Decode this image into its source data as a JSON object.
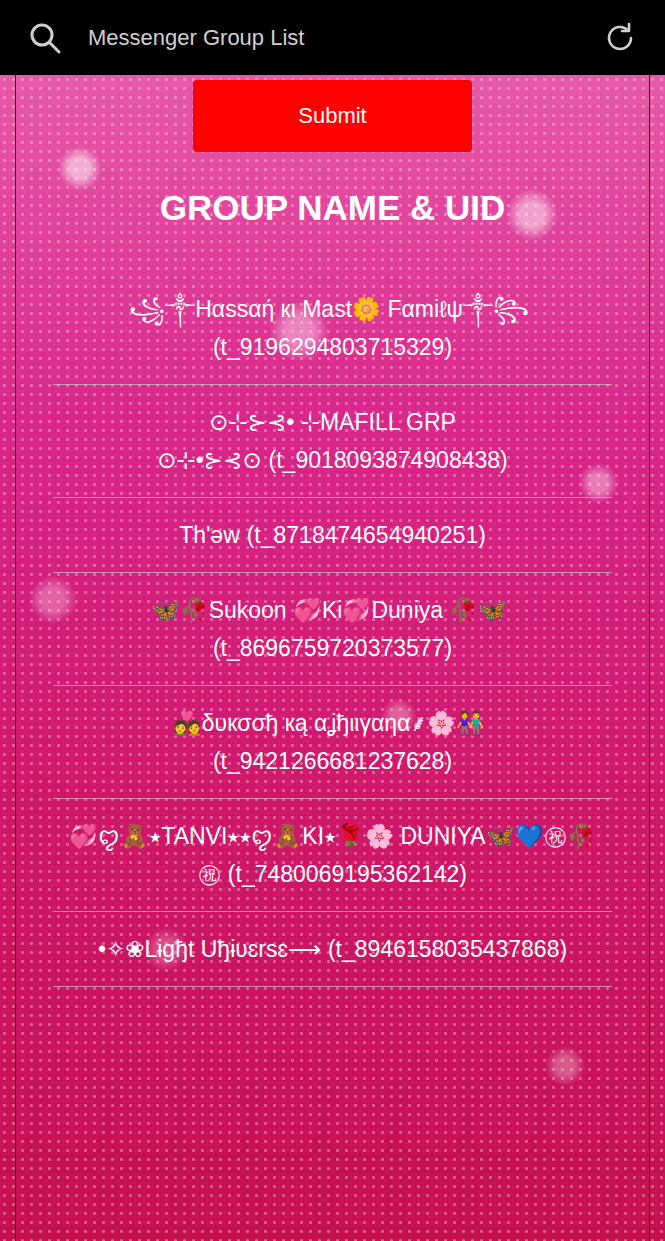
{
  "header": {
    "title": "Messenger Group List"
  },
  "submit": {
    "label": "Submit"
  },
  "heading": "GROUP NAME & UID",
  "groups": [
    {
      "name": "꧁༒Hαssαή кι Mast🌼 Fαmiℓψ༒꧂",
      "uid": "(t_9196294803715329)"
    },
    {
      "name": "⊙⊹⊱⊰• ⊹MAFILL GRP ⊙⊹•⊱⊰⊙",
      "uid": "(t_9018093874908438)"
    },
    {
      "name": "Th'ǝw",
      "uid": "(t_8718474654940251)"
    },
    {
      "name": "🦋🥀Sukoon 💞Ki💞Duniya 🥀🦋",
      "uid": "(t_8696759720373577)"
    },
    {
      "name": "💑δυкσσђ кą αʝђιιγαηα⸙🌸👫",
      "uid": "(t_9421266681237628)"
    },
    {
      "name": "💞ꨄ🧸⭑TANVI⭑⭑ꨄ🧸KI⭑🌹🌸 DUNIYA🦋💙㊗🥀㊗",
      "uid": "(t_7480069195362142)"
    },
    {
      "name": "•✧❀Lɨgђt Uђɨʋɛrѕɛ⟶",
      "uid": "(t_8946158035437868)"
    }
  ]
}
